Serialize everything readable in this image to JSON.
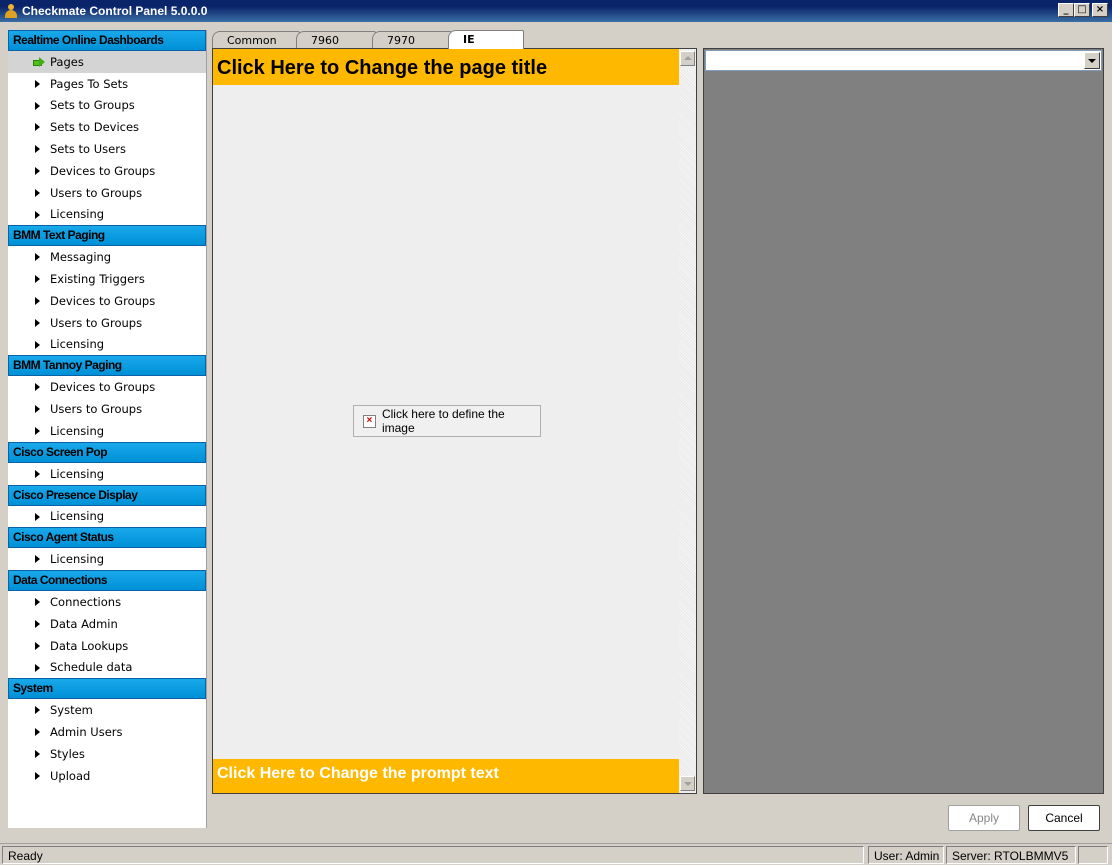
{
  "window": {
    "title": "Checkmate Control Panel 5.0.0.0",
    "minimize": "_",
    "maximize": "□",
    "close": "×"
  },
  "sidebar": {
    "sections": [
      {
        "header": "Realtime Online Dashboards",
        "items": [
          "Pages",
          "Pages To Sets",
          "Sets to Groups",
          "Sets to Devices",
          "Sets to Users",
          "Devices to Groups",
          "Users to Groups",
          "Licensing"
        ]
      },
      {
        "header": "BMM Text Paging",
        "items": [
          "Messaging",
          "Existing Triggers",
          "Devices to Groups",
          "Users to Groups",
          "Licensing"
        ]
      },
      {
        "header": "BMM Tannoy Paging",
        "items": [
          "Devices to Groups",
          "Users to Groups",
          "Licensing"
        ]
      },
      {
        "header": "Cisco Screen Pop",
        "items": [
          "Licensing"
        ]
      },
      {
        "header": "Cisco Presence Display",
        "items": [
          "Licensing"
        ]
      },
      {
        "header": "Cisco Agent Status",
        "items": [
          "Licensing"
        ]
      },
      {
        "header": "Data Connections",
        "items": [
          "Connections",
          "Data Admin",
          "Data Lookups",
          "Schedule data"
        ]
      },
      {
        "header": "System",
        "items": [
          "System",
          "Admin Users",
          "Styles",
          "Upload"
        ]
      }
    ],
    "active_item": "Pages"
  },
  "tabs": [
    {
      "label": "Common",
      "selected": false
    },
    {
      "label": "7960",
      "selected": false
    },
    {
      "label": "7970",
      "selected": false
    },
    {
      "label": "IE",
      "selected": true
    }
  ],
  "editor": {
    "page_title": "Click Here to Change the page title",
    "image_placeholder": "Click here to define the image",
    "prompt_text": "Click Here to Change the prompt text"
  },
  "right_panel": {
    "combo_value": ""
  },
  "buttons": {
    "apply": "Apply",
    "cancel": "Cancel"
  },
  "statusbar": {
    "status": "Ready",
    "user": "User: Admin",
    "server": "Server: RTOLBMMV5"
  },
  "colors": {
    "section_header": "#0099dd",
    "title_bar_accent": "#ffb800",
    "right_panel_bg": "#808080"
  }
}
